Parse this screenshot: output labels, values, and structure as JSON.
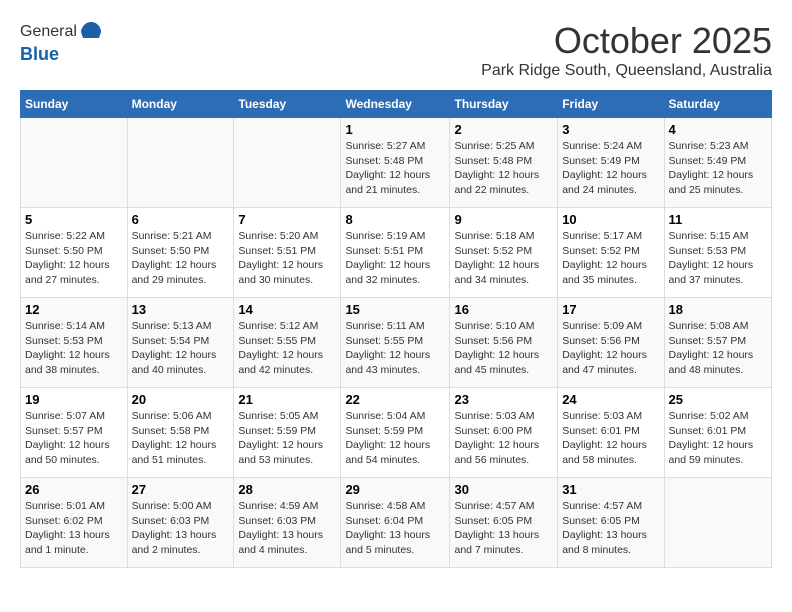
{
  "header": {
    "logo_line1": "General",
    "logo_line2": "Blue",
    "month": "October 2025",
    "location": "Park Ridge South, Queensland, Australia"
  },
  "days_of_week": [
    "Sunday",
    "Monday",
    "Tuesday",
    "Wednesday",
    "Thursday",
    "Friday",
    "Saturday"
  ],
  "weeks": [
    [
      {
        "num": "",
        "info": ""
      },
      {
        "num": "",
        "info": ""
      },
      {
        "num": "",
        "info": ""
      },
      {
        "num": "1",
        "info": "Sunrise: 5:27 AM\nSunset: 5:48 PM\nDaylight: 12 hours and 21 minutes."
      },
      {
        "num": "2",
        "info": "Sunrise: 5:25 AM\nSunset: 5:48 PM\nDaylight: 12 hours and 22 minutes."
      },
      {
        "num": "3",
        "info": "Sunrise: 5:24 AM\nSunset: 5:49 PM\nDaylight: 12 hours and 24 minutes."
      },
      {
        "num": "4",
        "info": "Sunrise: 5:23 AM\nSunset: 5:49 PM\nDaylight: 12 hours and 25 minutes."
      }
    ],
    [
      {
        "num": "5",
        "info": "Sunrise: 5:22 AM\nSunset: 5:50 PM\nDaylight: 12 hours and 27 minutes."
      },
      {
        "num": "6",
        "info": "Sunrise: 5:21 AM\nSunset: 5:50 PM\nDaylight: 12 hours and 29 minutes."
      },
      {
        "num": "7",
        "info": "Sunrise: 5:20 AM\nSunset: 5:51 PM\nDaylight: 12 hours and 30 minutes."
      },
      {
        "num": "8",
        "info": "Sunrise: 5:19 AM\nSunset: 5:51 PM\nDaylight: 12 hours and 32 minutes."
      },
      {
        "num": "9",
        "info": "Sunrise: 5:18 AM\nSunset: 5:52 PM\nDaylight: 12 hours and 34 minutes."
      },
      {
        "num": "10",
        "info": "Sunrise: 5:17 AM\nSunset: 5:52 PM\nDaylight: 12 hours and 35 minutes."
      },
      {
        "num": "11",
        "info": "Sunrise: 5:15 AM\nSunset: 5:53 PM\nDaylight: 12 hours and 37 minutes."
      }
    ],
    [
      {
        "num": "12",
        "info": "Sunrise: 5:14 AM\nSunset: 5:53 PM\nDaylight: 12 hours and 38 minutes."
      },
      {
        "num": "13",
        "info": "Sunrise: 5:13 AM\nSunset: 5:54 PM\nDaylight: 12 hours and 40 minutes."
      },
      {
        "num": "14",
        "info": "Sunrise: 5:12 AM\nSunset: 5:55 PM\nDaylight: 12 hours and 42 minutes."
      },
      {
        "num": "15",
        "info": "Sunrise: 5:11 AM\nSunset: 5:55 PM\nDaylight: 12 hours and 43 minutes."
      },
      {
        "num": "16",
        "info": "Sunrise: 5:10 AM\nSunset: 5:56 PM\nDaylight: 12 hours and 45 minutes."
      },
      {
        "num": "17",
        "info": "Sunrise: 5:09 AM\nSunset: 5:56 PM\nDaylight: 12 hours and 47 minutes."
      },
      {
        "num": "18",
        "info": "Sunrise: 5:08 AM\nSunset: 5:57 PM\nDaylight: 12 hours and 48 minutes."
      }
    ],
    [
      {
        "num": "19",
        "info": "Sunrise: 5:07 AM\nSunset: 5:57 PM\nDaylight: 12 hours and 50 minutes."
      },
      {
        "num": "20",
        "info": "Sunrise: 5:06 AM\nSunset: 5:58 PM\nDaylight: 12 hours and 51 minutes."
      },
      {
        "num": "21",
        "info": "Sunrise: 5:05 AM\nSunset: 5:59 PM\nDaylight: 12 hours and 53 minutes."
      },
      {
        "num": "22",
        "info": "Sunrise: 5:04 AM\nSunset: 5:59 PM\nDaylight: 12 hours and 54 minutes."
      },
      {
        "num": "23",
        "info": "Sunrise: 5:03 AM\nSunset: 6:00 PM\nDaylight: 12 hours and 56 minutes."
      },
      {
        "num": "24",
        "info": "Sunrise: 5:03 AM\nSunset: 6:01 PM\nDaylight: 12 hours and 58 minutes."
      },
      {
        "num": "25",
        "info": "Sunrise: 5:02 AM\nSunset: 6:01 PM\nDaylight: 12 hours and 59 minutes."
      }
    ],
    [
      {
        "num": "26",
        "info": "Sunrise: 5:01 AM\nSunset: 6:02 PM\nDaylight: 13 hours and 1 minute."
      },
      {
        "num": "27",
        "info": "Sunrise: 5:00 AM\nSunset: 6:03 PM\nDaylight: 13 hours and 2 minutes."
      },
      {
        "num": "28",
        "info": "Sunrise: 4:59 AM\nSunset: 6:03 PM\nDaylight: 13 hours and 4 minutes."
      },
      {
        "num": "29",
        "info": "Sunrise: 4:58 AM\nSunset: 6:04 PM\nDaylight: 13 hours and 5 minutes."
      },
      {
        "num": "30",
        "info": "Sunrise: 4:57 AM\nSunset: 6:05 PM\nDaylight: 13 hours and 7 minutes."
      },
      {
        "num": "31",
        "info": "Sunrise: 4:57 AM\nSunset: 6:05 PM\nDaylight: 13 hours and 8 minutes."
      },
      {
        "num": "",
        "info": ""
      }
    ]
  ]
}
